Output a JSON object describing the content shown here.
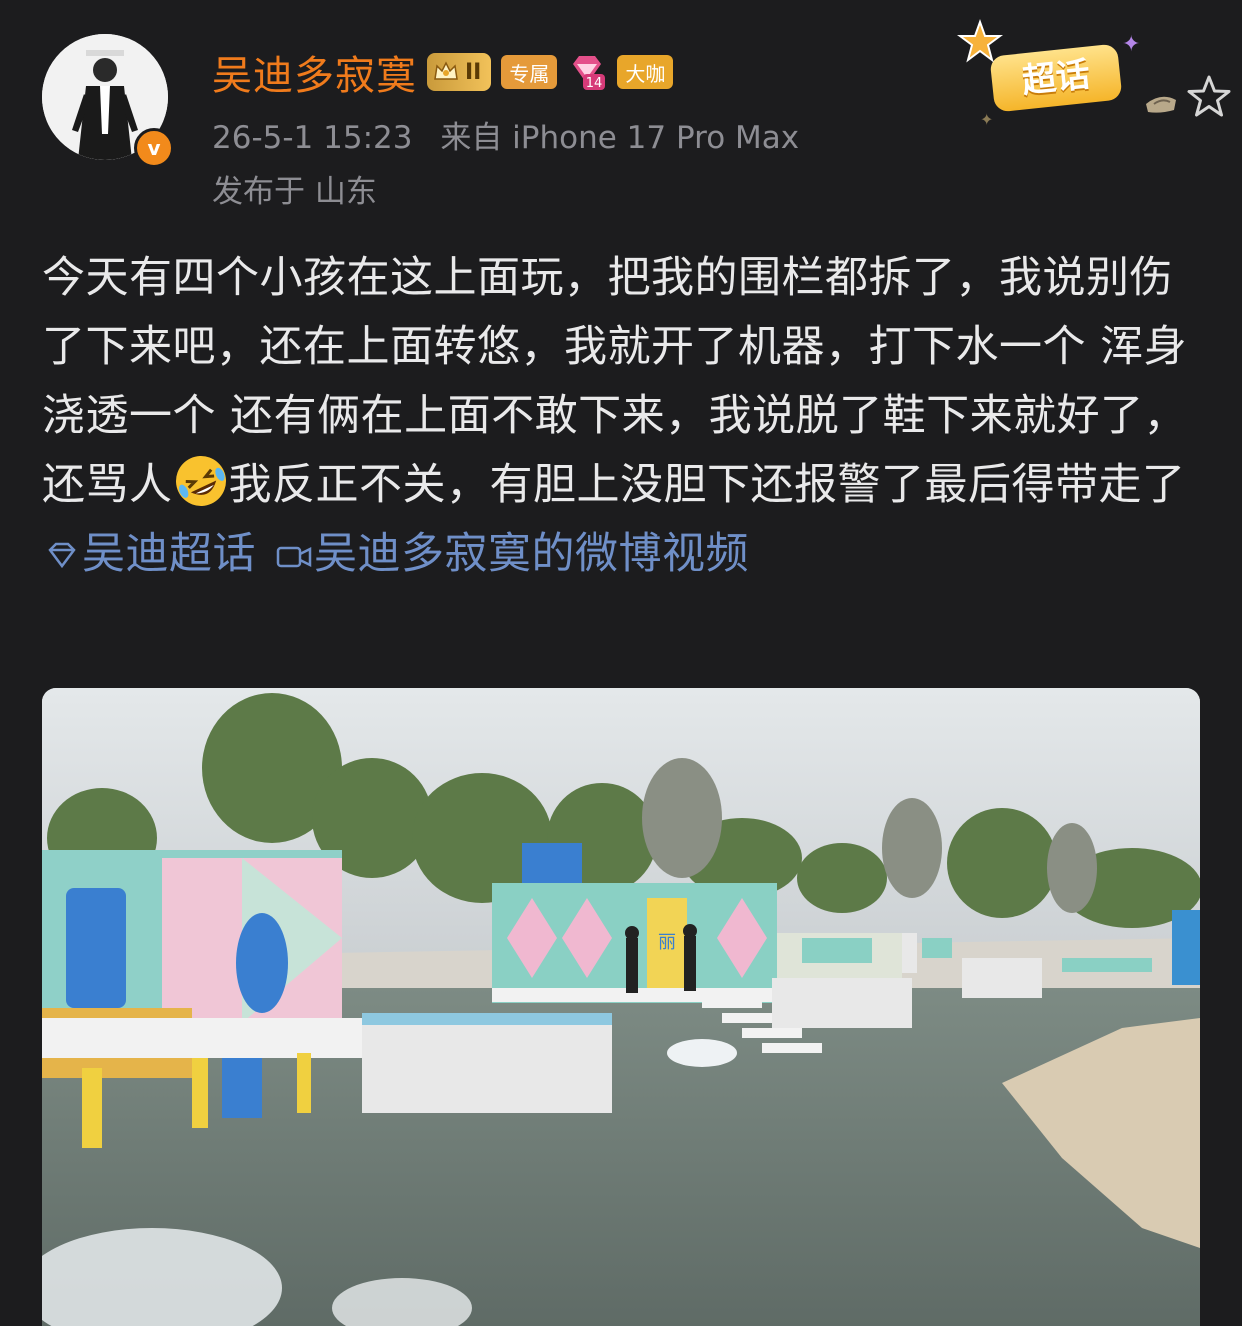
{
  "post": {
    "username": "吴迪多寂寞",
    "badges": {
      "level": "II",
      "exclusive": "专属",
      "fan_level": "14",
      "role": "大咖"
    },
    "time": "26-5-1 15:23",
    "source": "来自 iPhone 17 Pro Max",
    "location": "发布于 山东",
    "verified_mark": "v",
    "text_part1": "今天有四个小孩在这上面玩，把我的围栏都拆了，我说别伤了下来吧，还在上面转悠，我就开了机器，打下水一个 浑身浇透一个 还有俩在上面不敢下来，我说脱了鞋下来就好了，还骂人",
    "text_part2": "我反正不关，有胆上没胆下还报警了最后得带走了",
    "topic_label": "吴迪超话",
    "video_label": "吴迪多寂寞的微博视频",
    "emoji": "rolling-on-floor-laughing"
  },
  "header_right": {
    "chaohua_label": "超话"
  },
  "photo": {
    "description_icon": "water-park-photo",
    "sign_text": "丽"
  },
  "colors": {
    "background": "#1c1c1e",
    "username": "#f07b1c",
    "meta": "#8d8d93",
    "topic": "#6f8fc8"
  }
}
